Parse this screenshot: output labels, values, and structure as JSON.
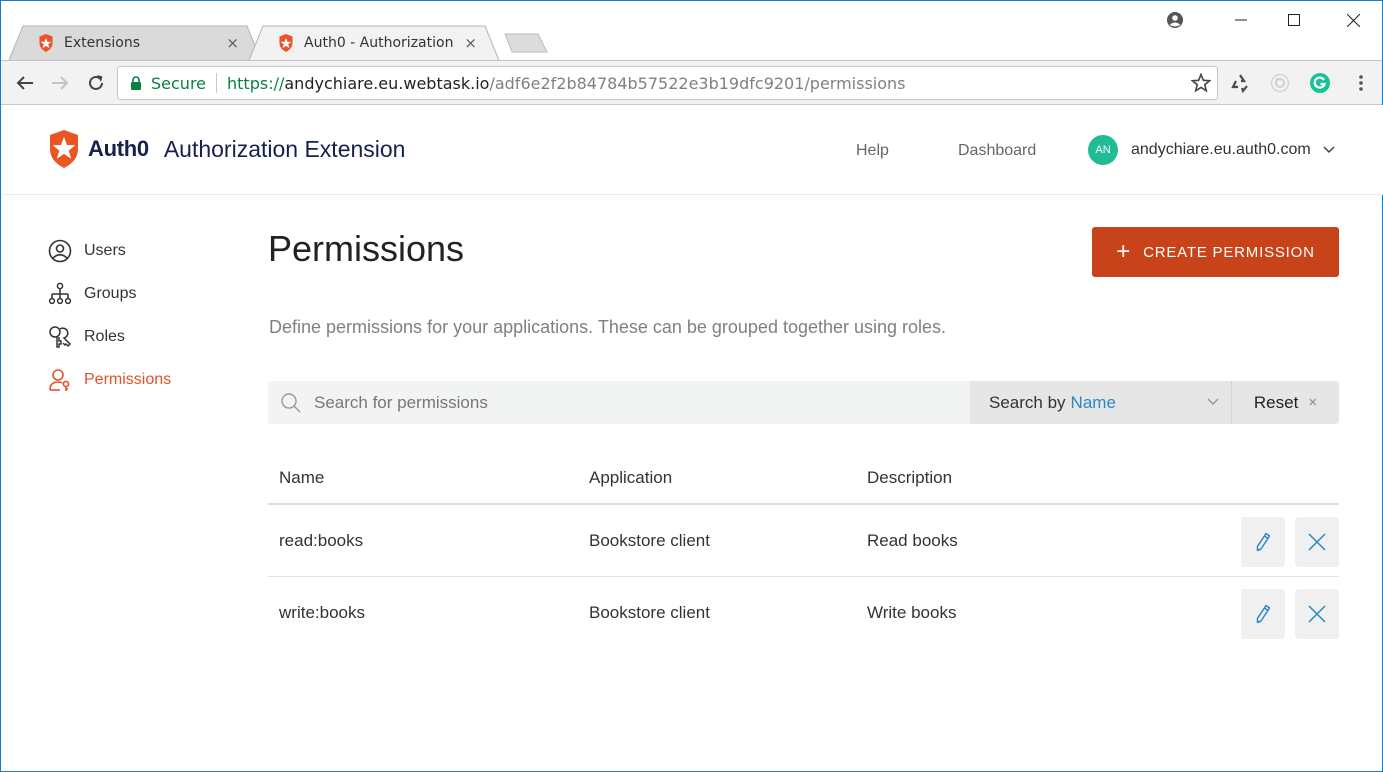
{
  "browser": {
    "tabs": [
      {
        "label": "Extensions",
        "active": false
      },
      {
        "label": "Auth0 - Authorization",
        "active": true
      }
    ],
    "tab_close_glyph": "×",
    "omnibox": {
      "secure_label": "Secure",
      "url_scheme": "https://",
      "url_host": "andychiare.eu.webtask.io",
      "url_path": "/adf6e2f2b84784b57522e3b19dfc9201/permissions"
    },
    "icons": [
      "back-icon",
      "forward-icon",
      "reload-icon",
      "lock-icon",
      "star-icon",
      "recycle-extension-icon",
      "target-extension-icon",
      "grammarly-extension-icon",
      "menu-icon",
      "profile-icon",
      "minimize-icon",
      "maximize-icon",
      "close-icon"
    ]
  },
  "header": {
    "brand_wordmark": "Auth0",
    "app_title": "Authorization Extension",
    "links": {
      "help": "Help",
      "dashboard": "Dashboard"
    },
    "user": {
      "initials": "AN",
      "name": "andychiare.eu.auth0.com",
      "avatar_color": "#1fbc96"
    }
  },
  "sidebar": {
    "items": [
      {
        "label": "Users",
        "icon": "user-circle-icon",
        "active": false
      },
      {
        "label": "Groups",
        "icon": "hierarchy-icon",
        "active": false
      },
      {
        "label": "Roles",
        "icon": "keys-icon",
        "active": false
      },
      {
        "label": "Permissions",
        "icon": "user-key-icon",
        "active": true
      }
    ],
    "active_color": "#e2532c"
  },
  "main": {
    "title": "Permissions",
    "create_button": {
      "icon": "+",
      "label": "CREATE PERMISSION",
      "color": "#c9431a"
    },
    "description": "Define permissions for your applications. These can be grouped together using roles.",
    "search": {
      "placeholder": "Search for permissions",
      "value": "",
      "search_by_prefix": "Search by",
      "search_by_field": "Name",
      "reset_label": "Reset",
      "reset_glyph": "×"
    },
    "table": {
      "columns": [
        "Name",
        "Application",
        "Description"
      ],
      "rows": [
        {
          "name": "read:books",
          "application": "Bookstore client",
          "description": "Read books"
        },
        {
          "name": "write:books",
          "application": "Bookstore client",
          "description": "Write books"
        }
      ]
    }
  }
}
